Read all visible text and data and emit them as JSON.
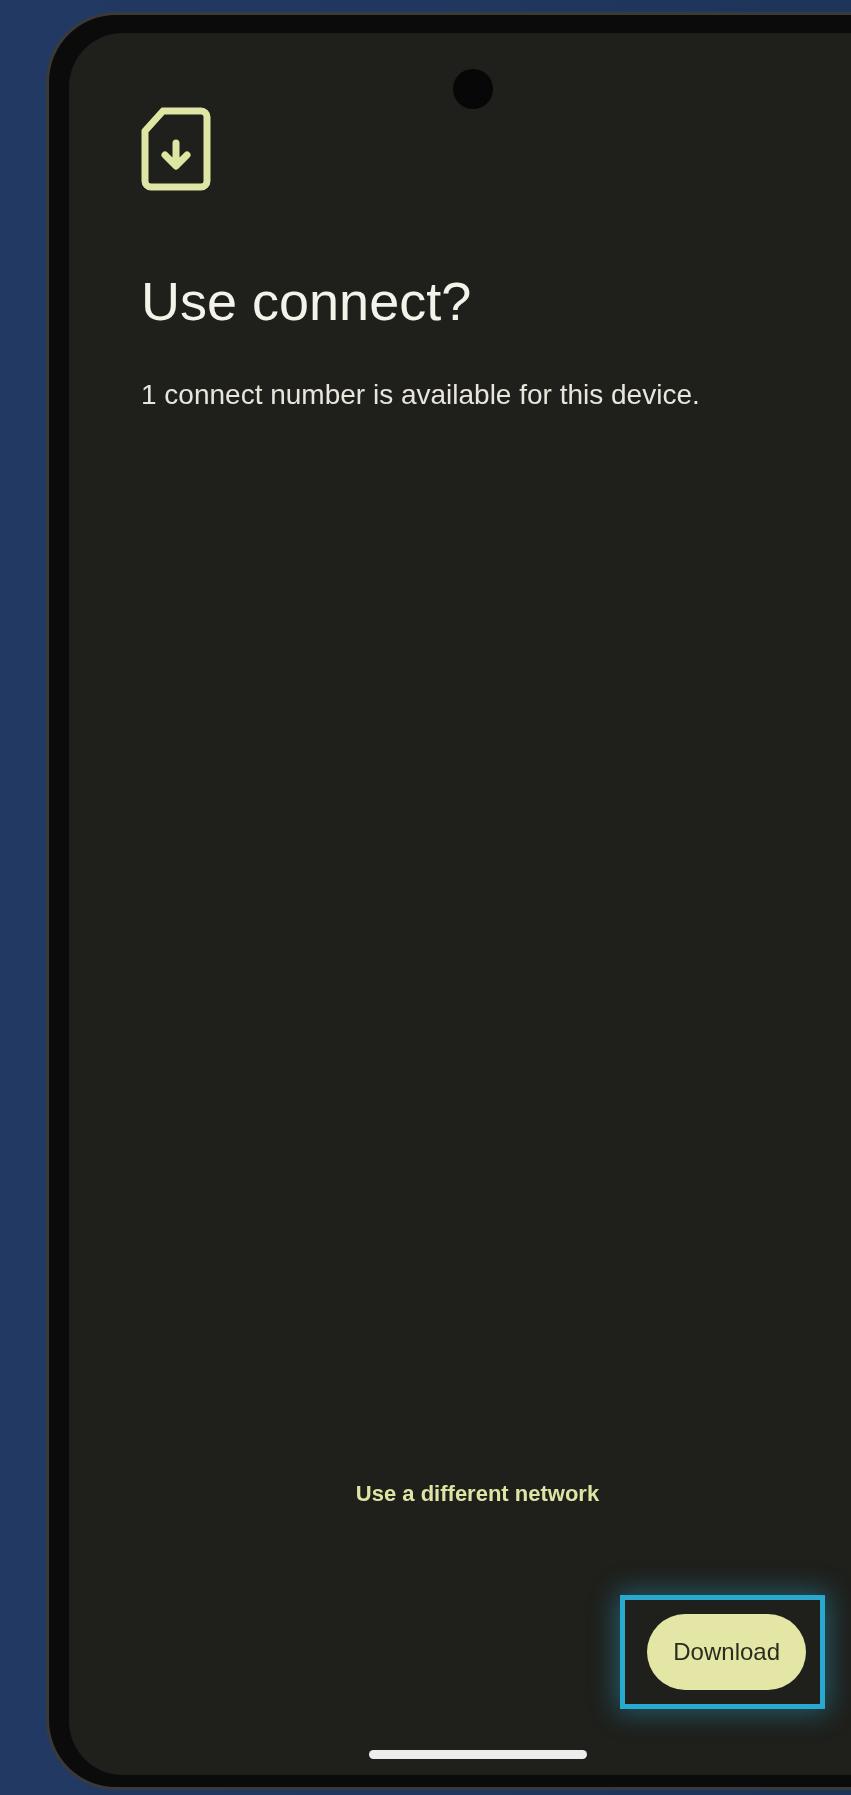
{
  "dialog": {
    "title": "Use connect?",
    "message": "1 connect number is available for this device."
  },
  "secondary_action": {
    "label": "Use a different network"
  },
  "primary_action": {
    "label": "Download",
    "highlighted": true
  }
}
